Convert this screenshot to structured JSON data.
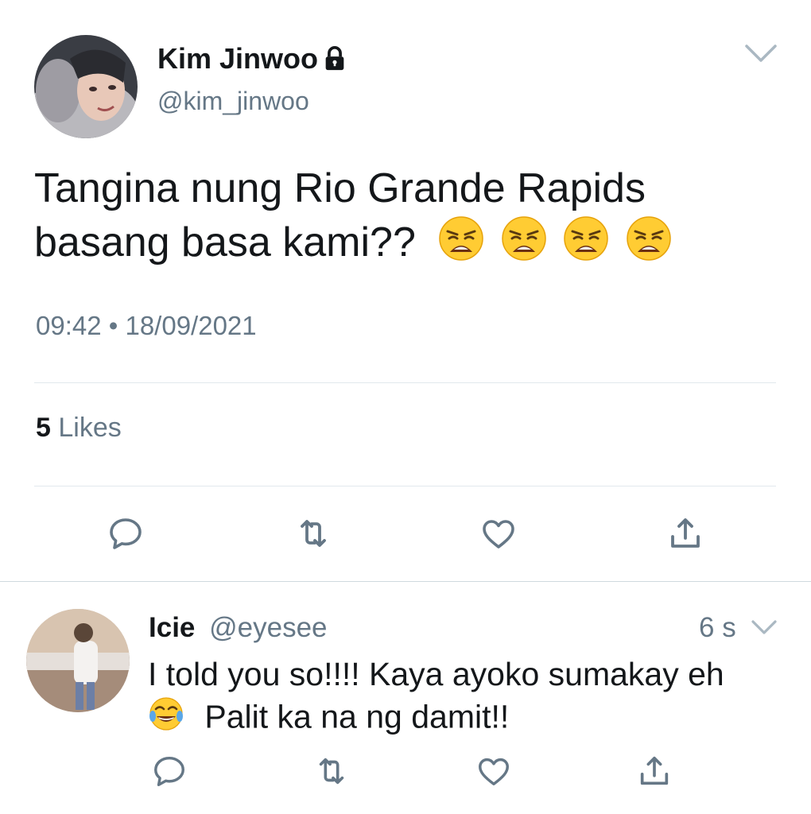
{
  "tweet": {
    "author_name": "Kim Jinwoo",
    "author_handle": "@kim_jinwoo",
    "text_line1": "Tangina nung Rio Grande Rapids",
    "text_line2": "basang basa kami??",
    "timestamp": "09:42 • 18/09/2021",
    "likes_count": "5",
    "likes_label": "Likes",
    "icons": {
      "lock": "lock-icon",
      "more": "chevron-down-icon",
      "reply": "reply-icon",
      "retweet": "retweet-icon",
      "like": "heart-icon",
      "share": "share-icon",
      "emoji": "weary-face-emoji"
    }
  },
  "reply": {
    "author_name": "Icie",
    "author_handle": "@eyesee",
    "time": "6 s",
    "text_line1": "I told you so!!!! Kaya ayoko sumakay eh",
    "text_line2": "Palit ka na ng damit!!",
    "icons": {
      "emoji": "tears-of-joy-emoji"
    }
  },
  "colors": {
    "text": "#14171a",
    "secondary": "#657786",
    "divider": "#e1e8ed",
    "icon": "#657786"
  }
}
